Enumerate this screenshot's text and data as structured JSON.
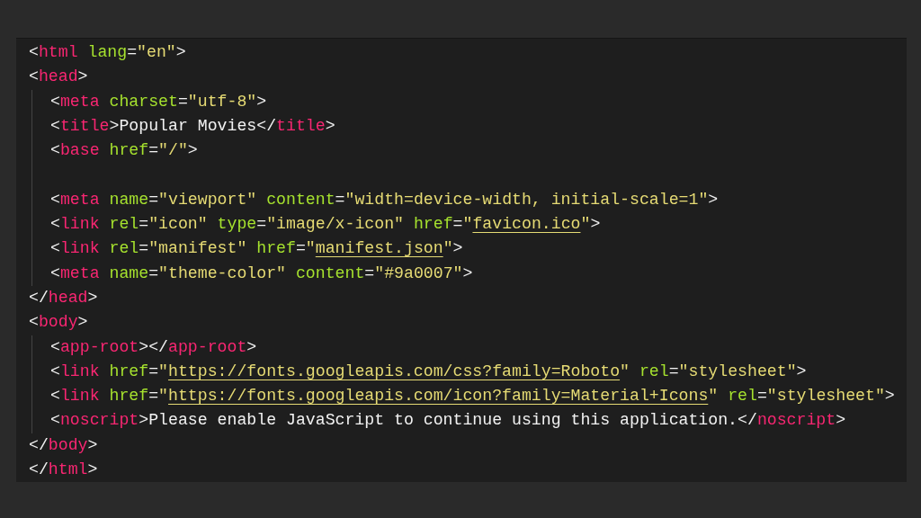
{
  "editor": {
    "lines": [
      {
        "kind": "code",
        "tokens": [
          {
            "kind": "punct",
            "text": "<"
          },
          {
            "kind": "tag",
            "text": "html"
          },
          {
            "kind": "attr",
            "text": " lang"
          },
          {
            "kind": "punct",
            "text": "="
          },
          {
            "kind": "string",
            "text": "\"en\""
          },
          {
            "kind": "punct",
            "text": ">"
          }
        ]
      },
      {
        "kind": "code",
        "tokens": [
          {
            "kind": "punct",
            "text": "<"
          },
          {
            "kind": "tag",
            "text": "head"
          },
          {
            "kind": "punct",
            "text": ">"
          }
        ],
        "children": [
          {
            "kind": "code",
            "tokens": [
              {
                "kind": "punct",
                "text": "<"
              },
              {
                "kind": "tag",
                "text": "meta"
              },
              {
                "kind": "attr",
                "text": " charset"
              },
              {
                "kind": "punct",
                "text": "="
              },
              {
                "kind": "string",
                "text": "\"utf-8\""
              },
              {
                "kind": "punct",
                "text": ">"
              }
            ]
          },
          {
            "kind": "code",
            "tokens": [
              {
                "kind": "punct",
                "text": "<"
              },
              {
                "kind": "tag",
                "text": "title"
              },
              {
                "kind": "punct",
                "text": ">"
              },
              {
                "kind": "text",
                "text": "Popular Movies"
              },
              {
                "kind": "punct",
                "text": "</"
              },
              {
                "kind": "tag",
                "text": "title"
              },
              {
                "kind": "punct",
                "text": ">"
              }
            ]
          },
          {
            "kind": "code",
            "tokens": [
              {
                "kind": "punct",
                "text": "<"
              },
              {
                "kind": "tag",
                "text": "base"
              },
              {
                "kind": "attr",
                "text": " href"
              },
              {
                "kind": "punct",
                "text": "="
              },
              {
                "kind": "string",
                "text": "\"/\""
              },
              {
                "kind": "punct",
                "text": ">"
              }
            ]
          },
          {
            "kind": "blank"
          },
          {
            "kind": "code",
            "tokens": [
              {
                "kind": "punct",
                "text": "<"
              },
              {
                "kind": "tag",
                "text": "meta"
              },
              {
                "kind": "attr",
                "text": " name"
              },
              {
                "kind": "punct",
                "text": "="
              },
              {
                "kind": "string",
                "text": "\"viewport\""
              },
              {
                "kind": "attr",
                "text": " content"
              },
              {
                "kind": "punct",
                "text": "="
              },
              {
                "kind": "string",
                "text": "\"width=device-width, initial-scale=1\""
              },
              {
                "kind": "punct",
                "text": ">"
              }
            ]
          },
          {
            "kind": "code",
            "tokens": [
              {
                "kind": "punct",
                "text": "<"
              },
              {
                "kind": "tag",
                "text": "link"
              },
              {
                "kind": "attr",
                "text": " rel"
              },
              {
                "kind": "punct",
                "text": "="
              },
              {
                "kind": "string",
                "text": "\"icon\""
              },
              {
                "kind": "attr",
                "text": " type"
              },
              {
                "kind": "punct",
                "text": "="
              },
              {
                "kind": "string",
                "text": "\"image/x-icon\""
              },
              {
                "kind": "attr",
                "text": " href"
              },
              {
                "kind": "punct",
                "text": "="
              },
              {
                "kind": "string",
                "text": "\""
              },
              {
                "kind": "link",
                "text": "favicon.ico"
              },
              {
                "kind": "string",
                "text": "\""
              },
              {
                "kind": "punct",
                "text": ">"
              }
            ]
          },
          {
            "kind": "code",
            "tokens": [
              {
                "kind": "punct",
                "text": "<"
              },
              {
                "kind": "tag",
                "text": "link"
              },
              {
                "kind": "attr",
                "text": " rel"
              },
              {
                "kind": "punct",
                "text": "="
              },
              {
                "kind": "string",
                "text": "\"manifest\""
              },
              {
                "kind": "attr",
                "text": " href"
              },
              {
                "kind": "punct",
                "text": "="
              },
              {
                "kind": "string",
                "text": "\""
              },
              {
                "kind": "link",
                "text": "manifest.json"
              },
              {
                "kind": "string",
                "text": "\""
              },
              {
                "kind": "punct",
                "text": ">"
              }
            ]
          },
          {
            "kind": "code",
            "tokens": [
              {
                "kind": "punct",
                "text": "<"
              },
              {
                "kind": "tag",
                "text": "meta"
              },
              {
                "kind": "attr",
                "text": " name"
              },
              {
                "kind": "punct",
                "text": "="
              },
              {
                "kind": "string",
                "text": "\"theme-color\""
              },
              {
                "kind": "attr",
                "text": " content"
              },
              {
                "kind": "punct",
                "text": "="
              },
              {
                "kind": "string",
                "text": "\"#9a0007\""
              },
              {
                "kind": "punct",
                "text": ">"
              }
            ]
          }
        ]
      },
      {
        "kind": "code",
        "tokens": [
          {
            "kind": "punct",
            "text": "</"
          },
          {
            "kind": "tag",
            "text": "head"
          },
          {
            "kind": "punct",
            "text": ">"
          }
        ]
      },
      {
        "kind": "code",
        "tokens": [
          {
            "kind": "punct",
            "text": "<"
          },
          {
            "kind": "tag",
            "text": "body"
          },
          {
            "kind": "punct",
            "text": ">"
          }
        ],
        "children": [
          {
            "kind": "code",
            "tokens": [
              {
                "kind": "punct",
                "text": "<"
              },
              {
                "kind": "tag",
                "text": "app-root"
              },
              {
                "kind": "punct",
                "text": "></"
              },
              {
                "kind": "tag",
                "text": "app-root"
              },
              {
                "kind": "punct",
                "text": ">"
              }
            ]
          },
          {
            "kind": "code",
            "tokens": [
              {
                "kind": "punct",
                "text": "<"
              },
              {
                "kind": "tag",
                "text": "link"
              },
              {
                "kind": "attr",
                "text": " href"
              },
              {
                "kind": "punct",
                "text": "="
              },
              {
                "kind": "string",
                "text": "\""
              },
              {
                "kind": "link",
                "text": "https://fonts.googleapis.com/css?family=Roboto"
              },
              {
                "kind": "string",
                "text": "\""
              },
              {
                "kind": "attr",
                "text": " rel"
              },
              {
                "kind": "punct",
                "text": "="
              },
              {
                "kind": "string",
                "text": "\"stylesheet\""
              },
              {
                "kind": "punct",
                "text": ">"
              }
            ]
          },
          {
            "kind": "code",
            "tokens": [
              {
                "kind": "punct",
                "text": "<"
              },
              {
                "kind": "tag",
                "text": "link"
              },
              {
                "kind": "attr",
                "text": " href"
              },
              {
                "kind": "punct",
                "text": "="
              },
              {
                "kind": "string",
                "text": "\""
              },
              {
                "kind": "link",
                "text": "https://fonts.googleapis.com/icon?family=Material+Icons"
              },
              {
                "kind": "string",
                "text": "\""
              },
              {
                "kind": "attr",
                "text": " rel"
              },
              {
                "kind": "punct",
                "text": "="
              },
              {
                "kind": "string",
                "text": "\"stylesheet\""
              },
              {
                "kind": "punct",
                "text": ">"
              }
            ]
          },
          {
            "kind": "code",
            "tokens": [
              {
                "kind": "punct",
                "text": "<"
              },
              {
                "kind": "tag",
                "text": "noscript"
              },
              {
                "kind": "punct",
                "text": ">"
              },
              {
                "kind": "text",
                "text": "Please enable JavaScript to continue using this application."
              },
              {
                "kind": "punct",
                "text": "</"
              },
              {
                "kind": "tag",
                "text": "noscript"
              },
              {
                "kind": "punct",
                "text": ">"
              }
            ]
          }
        ]
      },
      {
        "kind": "code",
        "tokens": [
          {
            "kind": "punct",
            "text": "</"
          },
          {
            "kind": "tag",
            "text": "body"
          },
          {
            "kind": "punct",
            "text": ">"
          }
        ]
      },
      {
        "kind": "code",
        "tokens": [
          {
            "kind": "punct",
            "text": "</"
          },
          {
            "kind": "tag",
            "text": "html"
          },
          {
            "kind": "punct",
            "text": ">"
          }
        ]
      }
    ]
  }
}
